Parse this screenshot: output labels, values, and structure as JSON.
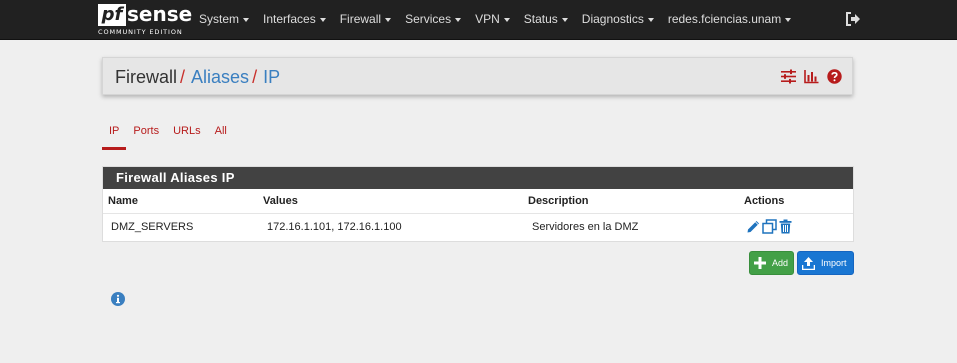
{
  "nav": {
    "logo": {
      "pf": "pf",
      "sense": "sense",
      "edition": "COMMUNITY EDITION"
    },
    "menu": [
      "System",
      "Interfaces",
      "Firewall",
      "Services",
      "VPN",
      "Status",
      "Diagnostics",
      "redes.fciencias.unam"
    ],
    "logout_icon": "sign-out-icon"
  },
  "breadcrumb": {
    "root": "Firewall",
    "separator": "/",
    "section": "Aliases",
    "current": "IP",
    "icons": [
      "sliders-icon",
      "bar-chart-icon",
      "help-icon"
    ]
  },
  "tabs": [
    {
      "label": "IP",
      "active": true
    },
    {
      "label": "Ports",
      "active": false
    },
    {
      "label": "URLs",
      "active": false
    },
    {
      "label": "All",
      "active": false
    }
  ],
  "panel": {
    "title": "Firewall Aliases IP",
    "columns": [
      "Name",
      "Values",
      "Description",
      "Actions"
    ],
    "rows": [
      {
        "name": "DMZ_SERVERS",
        "values": "172.16.1.101, 172.16.1.100",
        "description": "Servidores en la DMZ",
        "actions": [
          "edit-icon",
          "copy-icon",
          "delete-icon"
        ]
      }
    ]
  },
  "buttons": {
    "add": "Add",
    "import": "Import"
  },
  "colors": {
    "navbar": "#212121",
    "accent_red": "#b71c1c",
    "link_blue": "#3a7fc0",
    "add_green": "#43a047",
    "import_blue": "#1976d2"
  }
}
